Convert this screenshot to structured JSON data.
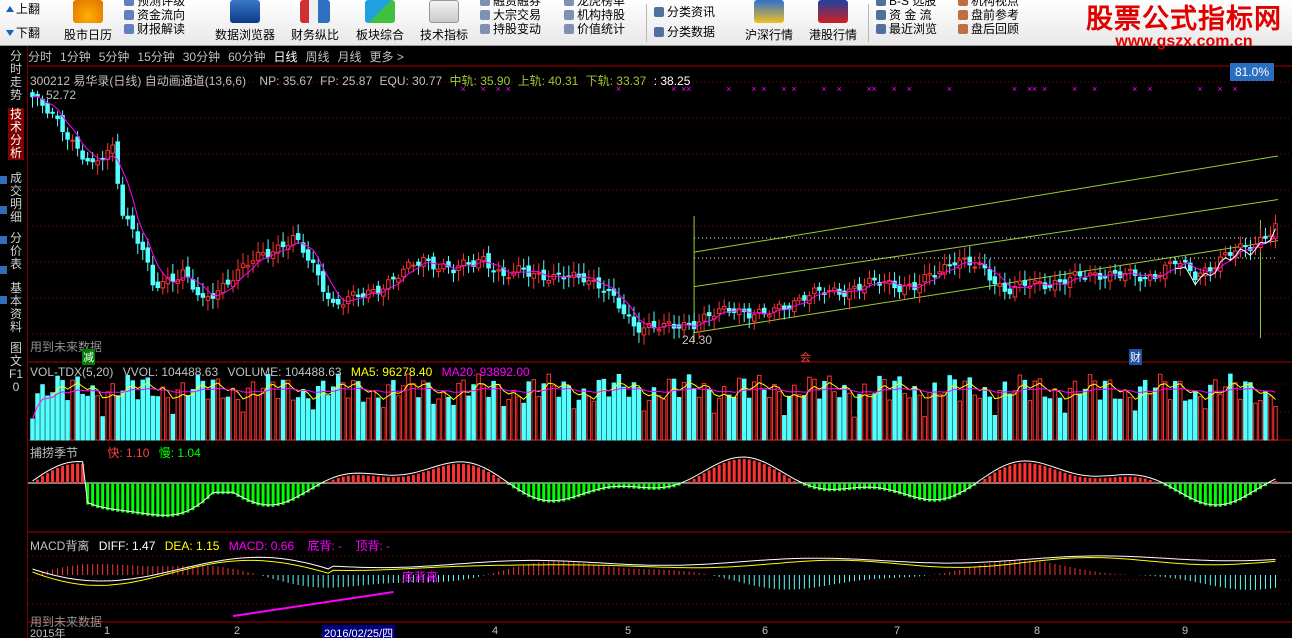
{
  "toolbar": {
    "page_up": "上翻",
    "page_down": "下翻",
    "buttons": [
      {
        "label": "股市日历",
        "icon": "calendar-icon"
      },
      {
        "label": "数据浏览器",
        "icon": "data-browser-icon"
      },
      {
        "label": "财务纵比",
        "icon": "finance-compare-icon"
      },
      {
        "label": "板块综合",
        "icon": "sector-icon"
      },
      {
        "label": "技术指标",
        "icon": "indicator-icon"
      },
      {
        "label": "沪深行情",
        "icon": "sh-sz-quote-icon"
      },
      {
        "label": "港股行情",
        "icon": "hk-quote-icon"
      }
    ],
    "menu_col1": [
      "预测评级",
      "资金流向",
      "财报解读"
    ],
    "menu_col2": [
      "融资融券",
      "大宗交易",
      "持股变动"
    ],
    "menu_col3": [
      "龙虎榜单",
      "机构持股",
      "价值统计"
    ],
    "menu_col4": [
      "分类资讯",
      "分类数据"
    ],
    "menu_col5": [
      "B-S 选股",
      "资 金 流",
      "最近浏览"
    ],
    "menu_col6": [
      "机构视点",
      "盘前参考",
      "盘后回顾"
    ]
  },
  "watermark": {
    "title": "股票公式指标网",
    "url": "www.gszx.com.cn"
  },
  "left_tabs": [
    "分时走势",
    "技术分析",
    "成交明细",
    "分价表",
    "基本资料",
    "图文F10"
  ],
  "period_bar": [
    "分时",
    "1分钟",
    "5分钟",
    "15分钟",
    "30分钟",
    "60分钟",
    "日线",
    "周线",
    "月线",
    "更多 >"
  ],
  "period_active": "日线",
  "percent_badge": "81.0%",
  "main_panel": {
    "title": "300212 易华录(日线) 自动画通道(13,6,6)",
    "np": "NP: 35.67",
    "fp": "FP: 25.87",
    "equ": "EQU: 30.77",
    "mid": "中轨: 35.90",
    "up": "上轨: 40.31",
    "down": "下轨: 33.37",
    "last": ": 38.25",
    "high_label": "52.72",
    "low_label": "24.30",
    "future_note": "用到未来数据",
    "marker_jian": "减",
    "marker_hui": "会",
    "marker_cai": "财"
  },
  "vol_panel": {
    "title": "VOL-TDX(5,20)",
    "vvol": "VVOL: 104488.63",
    "volume": "VOLUME: 104488.63",
    "ma5": "MA5: 96278.40",
    "ma20": "MA20: 93892.00"
  },
  "season_panel": {
    "title": "捕捞季节",
    "fast": "快: 1.10",
    "slow": "慢: 1.04"
  },
  "macd_panel": {
    "title": "MACD背离",
    "diff": "DIFF: 1.47",
    "dea": "DEA: 1.15",
    "macd": "MACD: 0.66",
    "bottom": "底背: -",
    "top": "顶背: -",
    "divergence_label": "底背离",
    "future_note": "用到未来数据"
  },
  "date_axis": [
    "2015年",
    "1",
    "2",
    "2016/02/25/四",
    "4",
    "5",
    "6",
    "7",
    "8",
    "9"
  ],
  "colors": {
    "up": "#ff3232",
    "down": "#54ffff",
    "ma_white": "#ffffff",
    "ma_yellow": "#ffff00",
    "ma_magenta": "#ff00ff",
    "channel": "#9acd32",
    "grid": "#8b0000",
    "season_green": "#00ff00"
  },
  "chart_data": {
    "type": "candlestick",
    "title": "300212 易华录(日线)",
    "price_range": [
      24.3,
      52.72
    ],
    "series": [
      {
        "name": "VOLUME",
        "last": 104488.63
      },
      {
        "name": "MA5",
        "last": 96278.4
      },
      {
        "name": "MA20",
        "last": 93892.0
      },
      {
        "name": "DIFF",
        "last": 1.47
      },
      {
        "name": "DEA",
        "last": 1.15
      },
      {
        "name": "MACD",
        "last": 0.66
      }
    ]
  }
}
